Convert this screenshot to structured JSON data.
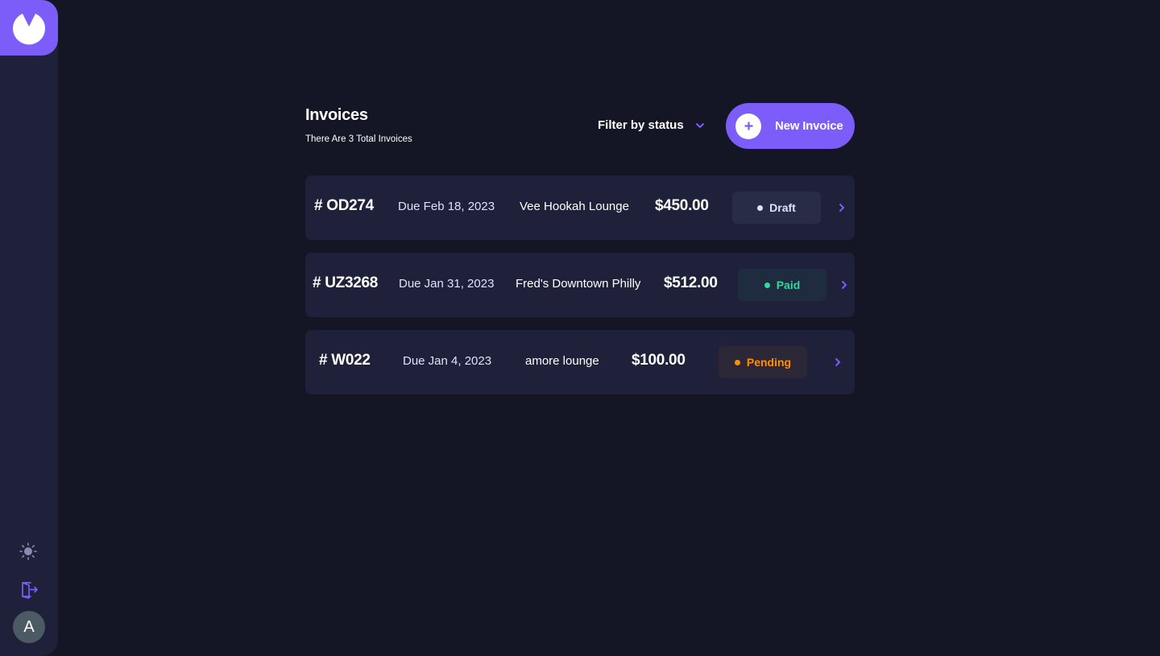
{
  "sidebar": {
    "logo_icon": "logo-icon",
    "theme_icon": "sun-icon",
    "logout_icon": "logout-icon",
    "avatar_initial": "A"
  },
  "header": {
    "title": "Invoices",
    "subtitle": "There Are 3 Total Invoices",
    "filter_label": "Filter by status",
    "new_button_label": "New Invoice"
  },
  "invoices": [
    {
      "id": "# OD274",
      "due": "Due Feb 18, 2023",
      "client": "Vee Hookah Lounge",
      "amount": "$450.00",
      "status": "Draft"
    },
    {
      "id": "# UZ3268",
      "due": "Due Jan 31, 2023",
      "client": "Fred's Downtown Philly",
      "amount": "$512.00",
      "status": "Paid"
    },
    {
      "id": "# W022",
      "due": "Due Jan 4, 2023",
      "client": "amore lounge",
      "amount": "$100.00",
      "status": "Pending"
    }
  ],
  "colors": {
    "accent": "#7c5dfa",
    "background": "#141625",
    "card": "#1e2139",
    "paid": "#33d69f",
    "pending": "#ff8f00",
    "draft": "#dfe3fa"
  }
}
